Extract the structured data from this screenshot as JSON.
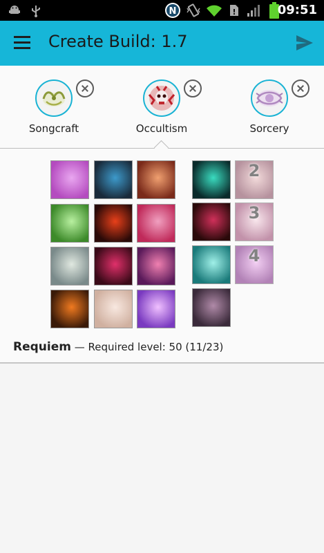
{
  "status_bar": {
    "time": "09:51",
    "icons": [
      "android-debug-icon",
      "usb-icon",
      "nfc-icon",
      "vibrate-icon",
      "wifi-icon",
      "sim-alert-icon",
      "signal-icon",
      "battery-icon"
    ]
  },
  "app_bar": {
    "title": "Create Build: 1.7",
    "menu_icon": "menu-icon",
    "send_icon": "send-icon",
    "accent_color": "#16b6d8"
  },
  "classes": [
    {
      "name": "Songcraft",
      "icon": "songcraft-icon",
      "selected": false
    },
    {
      "name": "Occultism",
      "icon": "occultism-icon",
      "selected": true
    },
    {
      "name": "Sorcery",
      "icon": "sorcery-icon",
      "selected": false
    }
  ],
  "skills_left": [
    {
      "name": "skill-1",
      "colors": [
        "#b44bbf",
        "#e9a7f0"
      ]
    },
    {
      "name": "skill-2",
      "colors": [
        "#1a2a3a",
        "#3d9acb"
      ]
    },
    {
      "name": "skill-3",
      "colors": [
        "#7a2a1a",
        "#f0a070"
      ]
    },
    {
      "name": "skill-4",
      "colors": [
        "#3d8a2a",
        "#b8f0a0"
      ]
    },
    {
      "name": "skill-5",
      "colors": [
        "#2a0a08",
        "#e8401a"
      ]
    },
    {
      "name": "skill-6",
      "colors": [
        "#c02a5a",
        "#f0a0c0"
      ]
    },
    {
      "name": "skill-7",
      "colors": [
        "#7a8a8a",
        "#e0e8e0"
      ]
    },
    {
      "name": "skill-8",
      "colors": [
        "#3a0a18",
        "#e0306a"
      ]
    },
    {
      "name": "skill-9",
      "colors": [
        "#5a1a5a",
        "#f080b0"
      ]
    },
    {
      "name": "skill-10",
      "colors": [
        "#3a1a08",
        "#f07a20"
      ]
    },
    {
      "name": "skill-11",
      "colors": [
        "#d0b0a0",
        "#f8e8e0"
      ]
    },
    {
      "name": "skill-12",
      "colors": [
        "#7a3ac0",
        "#f0c0ff"
      ]
    }
  ],
  "skills_right": [
    {
      "name": "skill-13",
      "colors": [
        "#0a2a2a",
        "#3adcc0"
      ],
      "locked": false,
      "number": ""
    },
    {
      "name": "skill-14",
      "colors": [
        "#a07080",
        "#f0d0d0"
      ],
      "locked": true,
      "number": "2"
    },
    {
      "name": "skill-15",
      "colors": [
        "#2a0a0a",
        "#d0305a"
      ],
      "locked": false,
      "number": ""
    },
    {
      "name": "skill-16",
      "colors": [
        "#b07090",
        "#f8e0e8"
      ],
      "locked": true,
      "number": "3"
    },
    {
      "name": "skill-17",
      "colors": [
        "#1a7a7a",
        "#a0f0e8"
      ],
      "locked": false,
      "number": ""
    },
    {
      "name": "skill-18",
      "colors": [
        "#9a5aa0",
        "#f0c0f0"
      ],
      "locked": true,
      "number": "4"
    },
    {
      "name": "skill-19",
      "colors": [
        "#3a2a3a",
        "#b08aa8"
      ],
      "locked": false,
      "number": ""
    }
  ],
  "selected_skill": {
    "name": "Requiem",
    "separator": "—",
    "detail": "Required level: 50 (11/23)"
  }
}
